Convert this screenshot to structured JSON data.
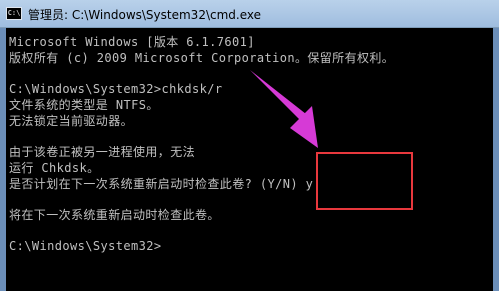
{
  "window": {
    "title": "管理员: C:\\Windows\\System32\\cmd.exe",
    "icon": "cmd-icon",
    "icon_text": "C:\\"
  },
  "console": {
    "lines": [
      "Microsoft Windows [版本 6.1.7601]",
      "版权所有 (c) 2009 Microsoft Corporation。保留所有权利。",
      "",
      "C:\\Windows\\System32>chkdsk/r",
      "文件系统的类型是 NTFS。",
      "无法锁定当前驱动器。",
      "",
      "由于该卷正被另一进程使用，无法",
      "运行 Chkdsk。",
      "是否计划在下一次系统重新启动时检查此卷? (Y/N) y",
      "",
      "将在下一次系统重新启动时检查此卷。",
      "",
      "C:\\Windows\\System32>"
    ]
  },
  "colors": {
    "console_bg": "#000000",
    "console_text": "#c0c0c0",
    "annotation": "#e8383d",
    "arrow": "#d63ad6"
  }
}
